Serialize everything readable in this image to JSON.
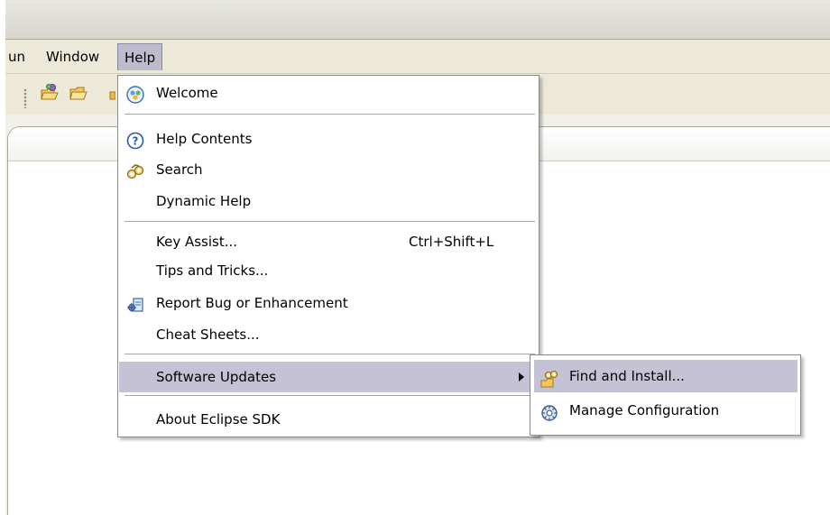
{
  "menubar": {
    "items": [
      {
        "label": "un"
      },
      {
        "label": "Window"
      },
      {
        "label": "Help"
      }
    ]
  },
  "help_menu": {
    "welcome": "Welcome",
    "help_contents": "Help Contents",
    "search": "Search",
    "dynamic_help": "Dynamic Help",
    "key_assist": "Key Assist...",
    "key_assist_accel": "Ctrl+Shift+L",
    "tips": "Tips and Tricks...",
    "report_bug": "Report Bug or Enhancement",
    "cheat_sheets": "Cheat Sheets...",
    "software_updates": "Software Updates",
    "about": "About Eclipse SDK"
  },
  "submenu": {
    "find_install": "Find and Install...",
    "manage_config": "Manage Configuration"
  },
  "colors": {
    "menu_highlight": "#c4c2d4",
    "menubar_bg": "#ece9d8"
  },
  "icons": {
    "welcome": "welcome-icon",
    "help_contents": "help-question-icon",
    "search": "search-binoculars-icon",
    "report_bug": "bug-report-icon",
    "find_install": "find-install-icon",
    "manage_config": "manage-configuration-icon"
  }
}
